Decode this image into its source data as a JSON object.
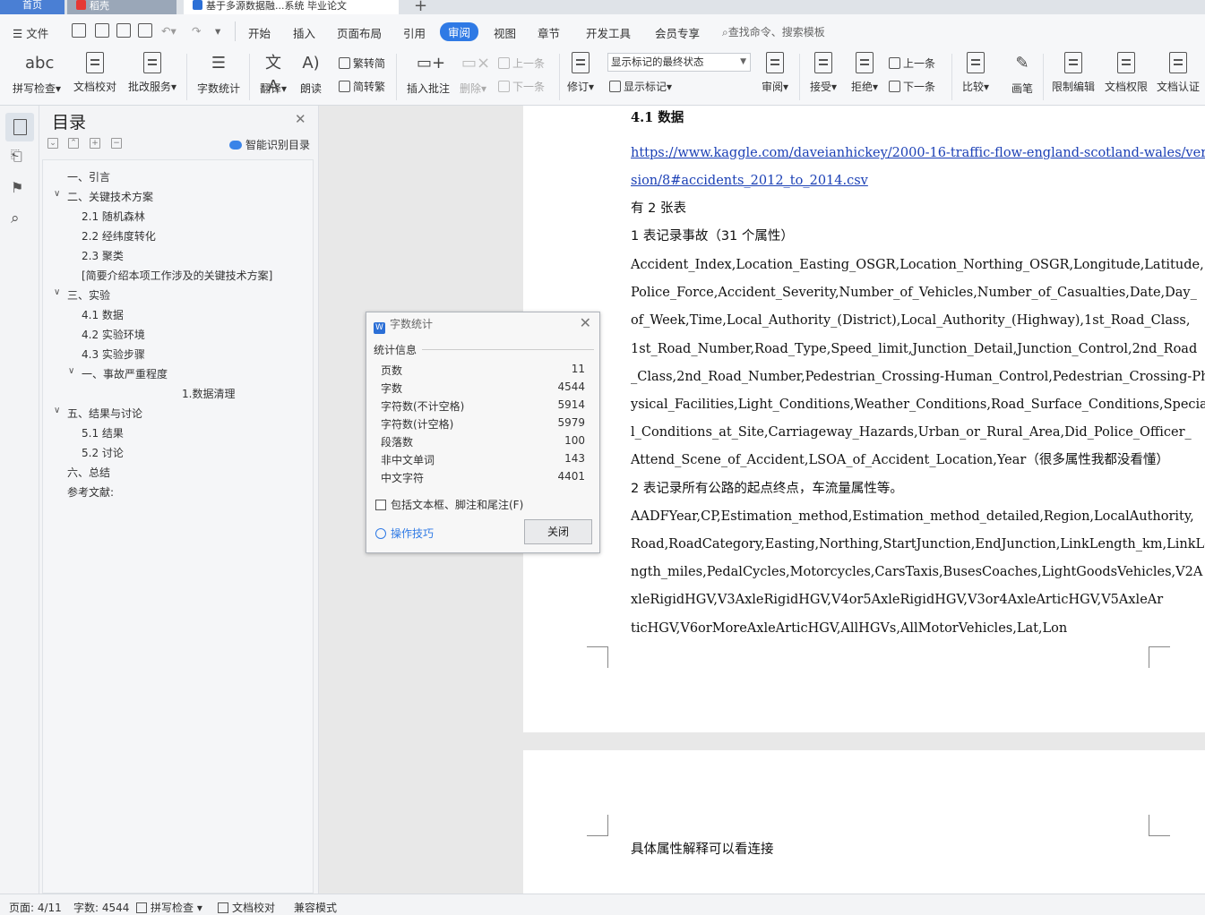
{
  "tabs": {
    "home": "首页",
    "daoke": "稻壳",
    "document": "基于多源数据融...系统 毕业论文",
    "add": "+"
  },
  "menubar": {
    "file": "文件",
    "items": [
      "开始",
      "插入",
      "页面布局",
      "引用",
      "审阅",
      "视图",
      "章节",
      "开发工具",
      "会员专享"
    ],
    "active": "审阅",
    "search_placeholder": "查找命令、搜索模板"
  },
  "ribbon": {
    "spellcheck": "拼写检查",
    "doc_proof": "文档校对",
    "review_service": "批改服务",
    "word_count": "字数统计",
    "translate": "翻译",
    "read_aloud": "朗读",
    "trad_to_simp": "繁转简",
    "simp_to_trad": "简转繁",
    "insert_comment": "插入批注",
    "delete": "删除",
    "prev_comment": "上一条",
    "next_comment": "下一条",
    "track_changes": "修订",
    "markup_select": "显示标记的最终状态",
    "show_markup": "显示标记",
    "review_pane": "审阅",
    "accept": "接受",
    "reject": "拒绝",
    "prev_change": "上一条",
    "next_change": "下一条",
    "compare": "比较",
    "pen": "画笔",
    "restrict_editing": "限制编辑",
    "doc_permission": "文档权限",
    "doc_certify": "文档认证"
  },
  "toc": {
    "title": "目录",
    "smart_recognize": "智能识别目录",
    "items": [
      {
        "label": "一、引言"
      },
      {
        "label": "二、关键技术方案"
      },
      {
        "label": "2.1  随机森林"
      },
      {
        "label": "2.2  经纬度转化"
      },
      {
        "label": "2.3  聚类"
      },
      {
        "label": "[简要介绍本项工作涉及的关键技术方案]"
      },
      {
        "label": "三、实验"
      },
      {
        "label": "4.1  数据"
      },
      {
        "label": "4.2  实验环境"
      },
      {
        "label": "4.3  实验步骤"
      },
      {
        "label": "一、事故严重程度"
      },
      {
        "label": "1.数据清理"
      },
      {
        "label": "五、结果与讨论"
      },
      {
        "label": "5.1  结果"
      },
      {
        "label": "5.2  讨论"
      },
      {
        "label": "六、总结"
      },
      {
        "label": "参考文献:"
      }
    ]
  },
  "document": {
    "heading": "4.1  数据",
    "link_line1": "https://www.kaggle.com/daveianhickey/2000-16-traffic-flow-england-scotland-wales/ver",
    "link_line2": "sion/8#accidents_2012_to_2014.csv",
    "lines": [
      "有 2 张表",
      "1 表记录事故（31 个属性）",
      "Accident_Index,Location_Easting_OSGR,Location_Northing_OSGR,Longitude,Latitude,",
      "Police_Force,Accident_Severity,Number_of_Vehicles,Number_of_Casualties,Date,Day_",
      "of_Week,Time,Local_Authority_(District),Local_Authority_(Highway),1st_Road_Class,",
      "1st_Road_Number,Road_Type,Speed_limit,Junction_Detail,Junction_Control,2nd_Road",
      "_Class,2nd_Road_Number,Pedestrian_Crossing-Human_Control,Pedestrian_Crossing-Ph",
      "ysical_Facilities,Light_Conditions,Weather_Conditions,Road_Surface_Conditions,Specia",
      "l_Conditions_at_Site,Carriageway_Hazards,Urban_or_Rural_Area,Did_Police_Officer_",
      "Attend_Scene_of_Accident,LSOA_of_Accident_Location,Year（很多属性我都没看懂）",
      "2 表记录所有公路的起点终点，车流量属性等。",
      "AADFYear,CP,Estimation_method,Estimation_method_detailed,Region,LocalAuthority,",
      "Road,RoadCategory,Easting,Northing,StartJunction,EndJunction,LinkLength_km,LinkLe",
      "ngth_miles,PedalCycles,Motorcycles,CarsTaxis,BusesCoaches,LightGoodsVehicles,V2A",
      "xleRigidHGV,V3AxleRigidHGV,V4or5AxleRigidHGV,V3or4AxleArticHGV,V5AxleAr",
      "ticHGV,V6orMoreAxleArticHGV,AllHGVs,AllMotorVehicles,Lat,Lon"
    ],
    "page2_line": "具体属性解释可以看连接"
  },
  "dialog": {
    "title": "字数统计",
    "section": "统计信息",
    "stats": [
      {
        "label": "页数",
        "value": "11"
      },
      {
        "label": "字数",
        "value": "4544"
      },
      {
        "label": "字符数(不计空格)",
        "value": "5914"
      },
      {
        "label": "字符数(计空格)",
        "value": "5979"
      },
      {
        "label": "段落数",
        "value": "100"
      },
      {
        "label": "非中文单词",
        "value": "143"
      },
      {
        "label": "中文字符",
        "value": "4401"
      }
    ],
    "checkbox_label": "包括文本框、脚注和尾注(F)",
    "tips_link": "操作技巧",
    "close_button": "关闭"
  },
  "statusbar": {
    "page": "页面: 4/11",
    "words": "字数: 4544",
    "spellcheck": "拼写检查",
    "doc_proof": "文档校对",
    "compat": "兼容模式"
  },
  "colors": {
    "accent": "#2f7ae5",
    "link": "#1a3fb5",
    "wps_blue": "#2b6fd6"
  }
}
